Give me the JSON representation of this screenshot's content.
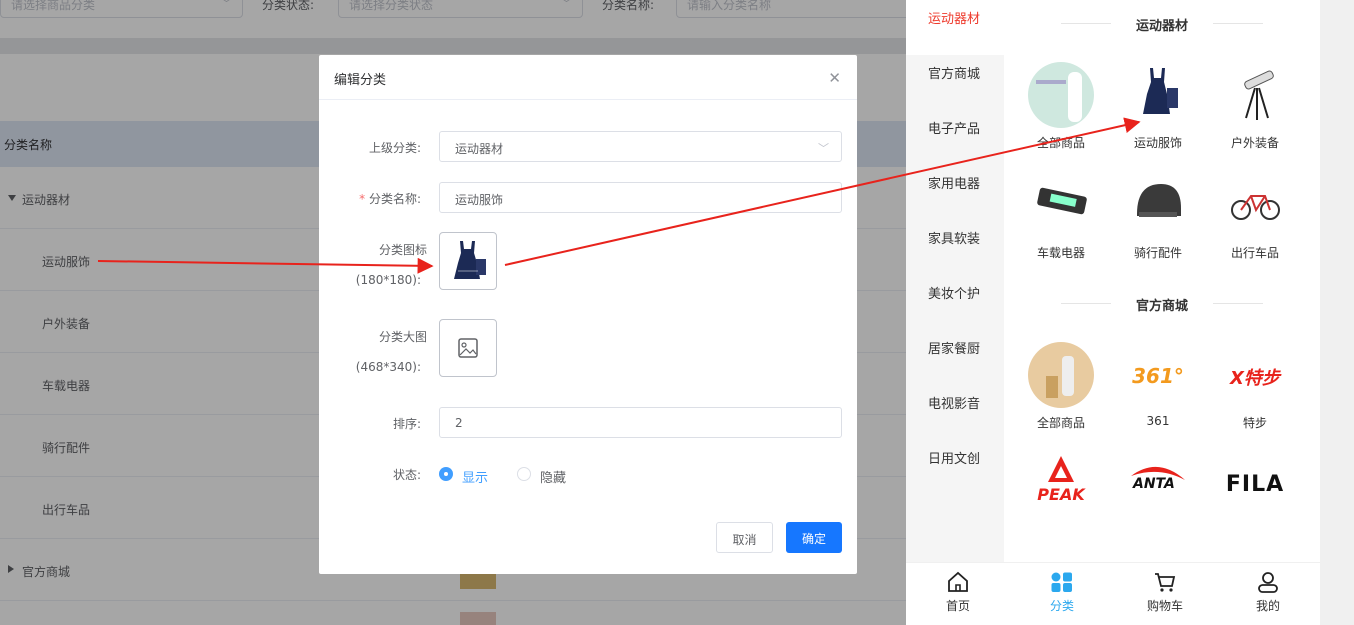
{
  "filters": {
    "category_placeholder": "请选择商品分类",
    "status_label": "分类状态:",
    "status_placeholder": "请选择分类状态",
    "name_label": "分类名称:",
    "name_placeholder": "请输入分类名称"
  },
  "table": {
    "header": "分类名称",
    "rows": [
      {
        "name": "运动器材",
        "level": 1,
        "expanded": true
      },
      {
        "name": "运动服饰",
        "level": 2
      },
      {
        "name": "户外装备",
        "level": 2
      },
      {
        "name": "车载电器",
        "level": 2
      },
      {
        "name": "骑行配件",
        "level": 2
      },
      {
        "name": "出行车品",
        "level": 2
      },
      {
        "name": "官方商城",
        "level": 1,
        "expanded": false
      }
    ]
  },
  "dialog": {
    "title": "编辑分类",
    "parent_label": "上级分类:",
    "parent_value": "运动器材",
    "name_label": "分类名称:",
    "name_required_mark": "*",
    "name_value": "运动服饰",
    "icon_label": "分类图标",
    "icon_size": "(180*180):",
    "bigimg_label": "分类大图",
    "bigimg_size": "(468*340):",
    "sort_label": "排序:",
    "sort_value": "2",
    "status_label": "状态:",
    "status_options": [
      "显示",
      "隐藏"
    ],
    "status_selected": "显示",
    "cancel": "取消",
    "confirm": "确定"
  },
  "phone": {
    "sidebar": [
      "运动器材",
      "官方商城",
      "电子产品",
      "家用电器",
      "家具软装",
      "美妆个护",
      "居家餐厨",
      "电视影音",
      "日用文创"
    ],
    "active_index": 0,
    "sections": [
      {
        "title": "运动器材",
        "items": [
          "全部商品",
          "运动服饰",
          "户外装备",
          "车载电器",
          "骑行配件",
          "出行车品"
        ]
      },
      {
        "title": "官方商城",
        "items": [
          "全部商品",
          "361",
          "特步",
          "",
          "",
          ""
        ]
      }
    ],
    "brand_logos": {
      "b361": "361°",
      "xtep": "X特步",
      "peak": "PEAK",
      "anta": "ANTA",
      "fila": "FILA"
    },
    "tabs": [
      "首页",
      "分类",
      "购物车",
      "我的"
    ],
    "active_tab": 1
  },
  "colors": {
    "accent": "#1677ff",
    "active_red": "#ee3a2c",
    "arrow_red": "#e8231c"
  }
}
